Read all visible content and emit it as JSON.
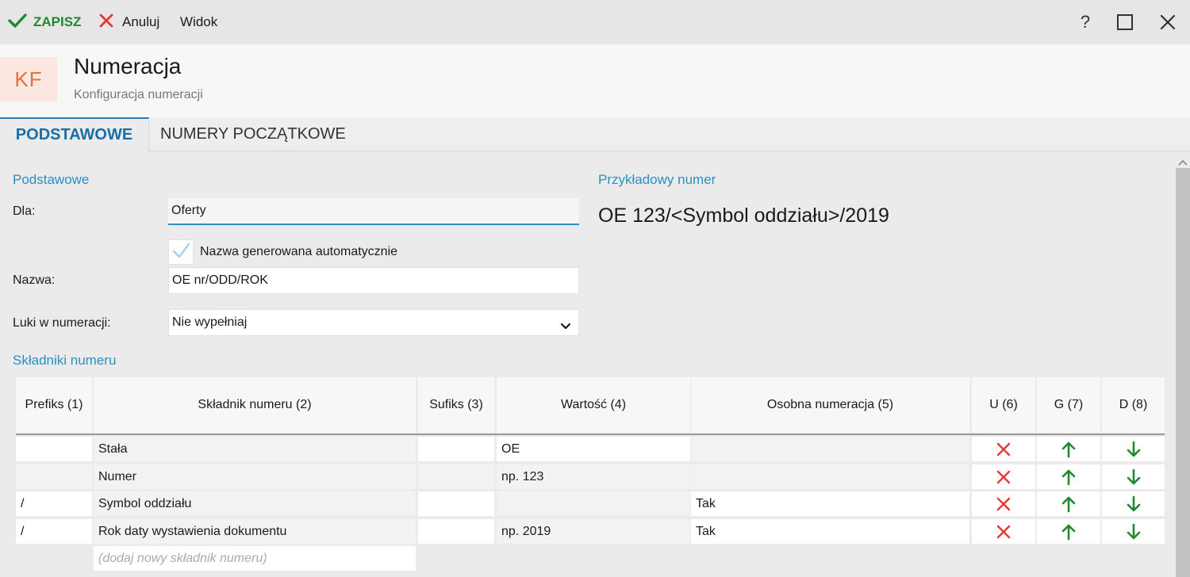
{
  "toolbar": {
    "save_label": "ZAPISZ",
    "cancel_label": "Anuluj",
    "view_label": "Widok",
    "help_label": "?"
  },
  "header": {
    "logo": "KF",
    "title": "Numeracja",
    "subtitle": "Konfiguracja numeracji"
  },
  "tabs": [
    {
      "label": "PODSTAWOWE",
      "active": true
    },
    {
      "label": "NUMERY POCZĄTKOWE",
      "active": false
    }
  ],
  "form": {
    "section_basic": "Podstawowe",
    "dla_label": "Dla:",
    "dla_value": "Oferty",
    "auto_name_label": "Nazwa generowana automatycznie",
    "auto_name_checked": true,
    "nazwa_label": "Nazwa:",
    "nazwa_value": "OE nr/ODD/ROK",
    "luki_label": "Luki w numeracji:",
    "luki_value": "Nie wypełniaj",
    "section_components": "Składniki numeru"
  },
  "example": {
    "title": "Przykładowy numer",
    "value": "OE 123/<Symbol oddziału>/2019"
  },
  "table": {
    "headers": [
      "Prefiks (1)",
      "Składnik numeru (2)",
      "Sufiks (3)",
      "Wartość (4)",
      "Osobna numeracja (5)",
      "U (6)",
      "G (7)",
      "D (8)"
    ],
    "rows": [
      {
        "prefix": "",
        "component": "Stała",
        "suffix": "",
        "value": "OE",
        "separate": ""
      },
      {
        "prefix": "",
        "component": "Numer",
        "suffix": "",
        "value": "np. 123",
        "separate": ""
      },
      {
        "prefix": "/",
        "component": "Symbol oddziału",
        "suffix": "",
        "value": "",
        "separate": "Tak"
      },
      {
        "prefix": "/",
        "component": "Rok daty wystawienia dokumentu",
        "suffix": "",
        "value": "np. 2019",
        "separate": "Tak"
      }
    ],
    "add_placeholder": "(dodaj nowy składnik numeru)"
  },
  "colors": {
    "accent": "#2a8fc1",
    "save_green": "#1f8a2e",
    "delete_red": "#e53935",
    "arrow_green": "#1f8a2e",
    "logo_orange": "#e0733a"
  },
  "icons": [
    "check-icon",
    "close-x-icon",
    "help-icon",
    "maximize-icon",
    "window-close-icon",
    "chevron-down-icon",
    "delete-icon",
    "arrow-up-icon",
    "arrow-down-icon",
    "scroll-up-icon"
  ]
}
